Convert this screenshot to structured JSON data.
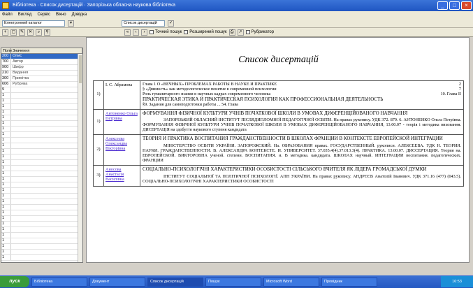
{
  "window": {
    "title": "Бібліотека · Список дисертацій · Запорізька обласна наукова бібліотека"
  },
  "menu": [
    "Файл",
    "Вигляд",
    "Сервіс",
    "Вікно",
    "Довідка"
  ],
  "toolbar": {
    "db_value": "Електронний каталог",
    "format_value": "Список дисертацій"
  },
  "search_opts": [
    "Точний пошук",
    "Розширений пошук",
    "Рубрикатор"
  ],
  "left": {
    "headers": [
      "Поле",
      "Значення"
    ],
    "rows": [
      [
        "200",
        "Опис"
      ],
      [
        "700",
        "Автор"
      ],
      [
        "900",
        "Шифр"
      ],
      [
        "210",
        "Видання"
      ],
      [
        "300",
        "Примітка"
      ],
      [
        "606",
        "Рубрика"
      ],
      [
        "9",
        ""
      ],
      [
        "1",
        ""
      ],
      [
        "1",
        ""
      ],
      [
        "1",
        ""
      ],
      [
        "1",
        ""
      ],
      [
        "1",
        ""
      ],
      [
        "1",
        ""
      ],
      [
        "1",
        ""
      ],
      [
        "1",
        ""
      ],
      [
        "1",
        ""
      ],
      [
        "1",
        ""
      ],
      [
        "1",
        ""
      ],
      [
        "1",
        ""
      ],
      [
        "1",
        ""
      ],
      [
        "1",
        ""
      ],
      [
        "1",
        ""
      ],
      [
        "1",
        ""
      ],
      [
        "1",
        ""
      ],
      [
        "1",
        ""
      ],
      [
        "1",
        ""
      ],
      [
        "1",
        ""
      ],
      [
        "1",
        ""
      ],
      [
        "1",
        ""
      ],
      [
        "1",
        ""
      ],
      [
        "1",
        ""
      ],
      [
        "1",
        ""
      ],
      [
        "1",
        ""
      ],
      [
        "1",
        ""
      ],
      [
        "1",
        ""
      ],
      [
        "1",
        ""
      ],
      [
        "1",
        ""
      ]
    ]
  },
  "doc": {
    "title": "Список дисертацій",
    "rows": [
      {
        "num": "1)",
        "author": "І. С. Абрамова",
        "link": false,
        "main": "",
        "lines": [
          "Глава 1 О «ВЕЧНЫХ» ПРОБЛЕМАХ РАБОТЫ В НАУКЕ И ПРАКТИКЕ",
          "§ «Двимость» как методологическое понятие в современной психологии",
          "Роль гуманитарного знания в научных кадрах современного человека",
          "ПРАКТИЧЕСКАЯ ЭТИКА И ПРАКТИЧЕСКАЯ ПСИХОЛОГИЯ КАК ПРОФЕССИОНАЛЬНАЯ ДЕЯТЕЛЬНОСТЬ",
          "§9. Задания для самоподготовки работы ... 54. Глава"
        ],
        "pages": [
          "2",
          "7",
          "10. Глава II"
        ]
      },
      {
        "num": "1)",
        "author": "Антоненко Ольга Петрівна",
        "link": true,
        "main": "ФОРМУВАННЯ ФІЗИЧНОЇ КУЛЬТУРИ УЧНІВ ПОЧАТКОВОЇ ШКОЛИ В УМОВАХ ДИФЕРЕНЦІЙОВАНОГО НАВЧАННЯ",
        "para": "ЗАПОРІЗЬКИЙ ОБЛАСНИЙ ІНСТИТУТ ПІСЛЯДИПЛОМНОЇ ПЕДАГОГІЧНОЇ ОСВІТИ. На правах рукопису. УДК 372. 879. 6. АНТОНЕНКО Ольга Петрівна. ФОРМУВАННЯ ФІЗИЧНОЇ КУЛЬТУРИ УЧНІВ ПОЧАТКОВОЇ ШКОЛИ В УМОВАХ ДИФЕРЕНЦІЙОВАНОГО НАВЧАННЯ, 13.00.07 - теорія і методика виховання. ДИСЕРТАЦІЯ на здобуття наукового ступеня кандидата"
      },
      {
        "num": "2)",
        "author": "Алексеєва Олександра Вікторівна",
        "link": true,
        "main": "ТЕОРИЯ И ПРАКТИКА ВОСПИТАНИЯ ГРАЖДАНСТВЕННОСТИ В ШКОЛАХ ФРАНЦИИ В КОНТЕКСТЕ ЕВРОПЕЙСКОЙ ИНТЕГРАЦИИ",
        "para": "МІНІСТЕРСТВО ОСВІТИ УКРАЇНИ. ЗАПОРОЖСКИЙ. На. ОБРАЗОВАНИЯ правах. ГОСУДАРСТВЕННЫЙ. рукописи. АЛЕКСЕЕВА. УДК Н. ТЕОРИЯ. НАУКИ. ГРАЖДАНСТВЕННОСТИ. В. АЛЕКСАНДРА КОНТЕКСТЕ. И. УНИВЕРСИТЕТ. 37.035.4(4).37.013.3(4). ПРАКТИКА. 13.00.07. ДИССЕРТАЦИЯ. Теория на. ЕВРОПЕЙСКОЙ. ВИКТОРОВНА ученой. степени. ВОСПИТАНИЯ. и. В методика. кандидата. ШКОЛАХ научный. ИНТЕГРАЦИИ воспитания. педагогических. ФРАНЦИИ"
      },
      {
        "num": "3)",
        "author": "Аносова Анастасія Василівна",
        "link": true,
        "main": "СОЦІАЛЬНО-ПСИХОЛОГІЧНІ ХАРАКТЕРИСТИКИ ОСОБИСТОСТІ СІЛЬСЬКОГО ВЧИТЕЛЯ ЯК ЛІДЕРА ГРОМАДСЬКОЇ ДУМКИ",
        "para": "ІНСТИТУТ СОЦІАЛЬНОЇ ТА ПОЛІТИЧНОЇ ПСИХОЛОГІЇ. АПН УКРАЇНИ. На правах рукопису. АНДРЄЄВ Анатолій Іванович. УДК 371.16 (477) (043.5). СОЦІАЛЬНО-ПСИХОЛОГІЧНІ ХАРАКТЕРИСТИКИ ОСОБИСТОСТІ"
      }
    ]
  },
  "taskbar": {
    "start": "пуск",
    "tasks": [
      "Бібліотека",
      "Документ",
      "Список дисертацій",
      "Пошук",
      "Microsoft Word",
      "Провідник"
    ],
    "clock": "16:53"
  }
}
